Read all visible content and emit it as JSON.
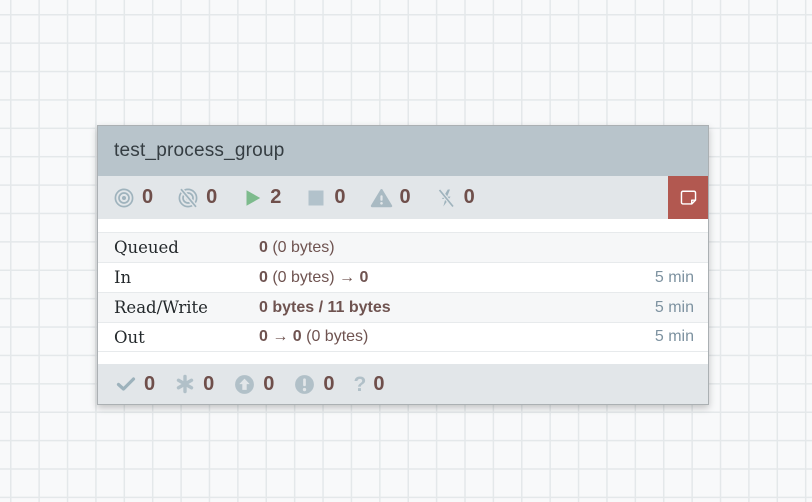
{
  "colors": {
    "canvas_bg": "#f8f9fa",
    "grid_line": "#e4e8ea",
    "component_border": "#abb0b3",
    "header_bg": "#b8c4cb",
    "header_text": "#353d42",
    "bar_bg": "#e2e6e9",
    "icon_gray": "#9fb3bd",
    "icon_light": "#b1c0c8",
    "running_green": "#7dbb8d",
    "stopped_gray": "#b2c2cb",
    "count_text": "#6f4f4b",
    "value_text": "#6f5350",
    "label_text": "#24292c",
    "time_text": "#7d92a0",
    "comment_red": "#b25850",
    "row_alt_bg": "#f6f7f8",
    "row_border": "#e7eaec"
  },
  "component": {
    "title": "test_process_group",
    "status_bar": {
      "items": [
        {
          "name": "transmitting",
          "icon": "transmitting-icon",
          "count": "0"
        },
        {
          "name": "not-transmitting",
          "icon": "not-transmitting-icon",
          "count": "0"
        },
        {
          "name": "running",
          "icon": "running-icon",
          "count": "2"
        },
        {
          "name": "stopped",
          "icon": "stopped-icon",
          "count": "0"
        },
        {
          "name": "invalid",
          "icon": "invalid-icon",
          "count": "0"
        },
        {
          "name": "disabled",
          "icon": "disabled-icon",
          "count": "0"
        }
      ],
      "comment_icon": "comment-note-icon"
    },
    "stats": {
      "rows": [
        {
          "label": "Queued",
          "parts": [
            {
              "text": "0",
              "bold": true
            },
            {
              "text": " (0 bytes)",
              "bold": false
            }
          ],
          "time": ""
        },
        {
          "label": "In",
          "parts": [
            {
              "text": "0",
              "bold": true
            },
            {
              "text": " (0 bytes) ",
              "bold": false
            },
            {
              "text": "→ 0",
              "bold": true
            }
          ],
          "time": "5 min"
        },
        {
          "label": "Read/Write",
          "parts": [
            {
              "text": "0 bytes / 11 bytes",
              "bold": true
            }
          ],
          "time": "5 min"
        },
        {
          "label": "Out",
          "parts": [
            {
              "text": "0 → 0",
              "bold": true
            },
            {
              "text": " (0 bytes)",
              "bold": false
            }
          ],
          "time": "5 min"
        }
      ]
    },
    "version_bar": {
      "items": [
        {
          "name": "up-to-date",
          "icon": "check-icon",
          "count": "0"
        },
        {
          "name": "locally-modified",
          "icon": "asterisk-icon",
          "count": "0"
        },
        {
          "name": "stale",
          "icon": "arrow-up-circle-icon",
          "count": "0"
        },
        {
          "name": "locally-modified-stale",
          "icon": "exclamation-circle-icon",
          "count": "0"
        },
        {
          "name": "sync-failure",
          "icon": "question-icon",
          "count": "0"
        }
      ]
    }
  }
}
